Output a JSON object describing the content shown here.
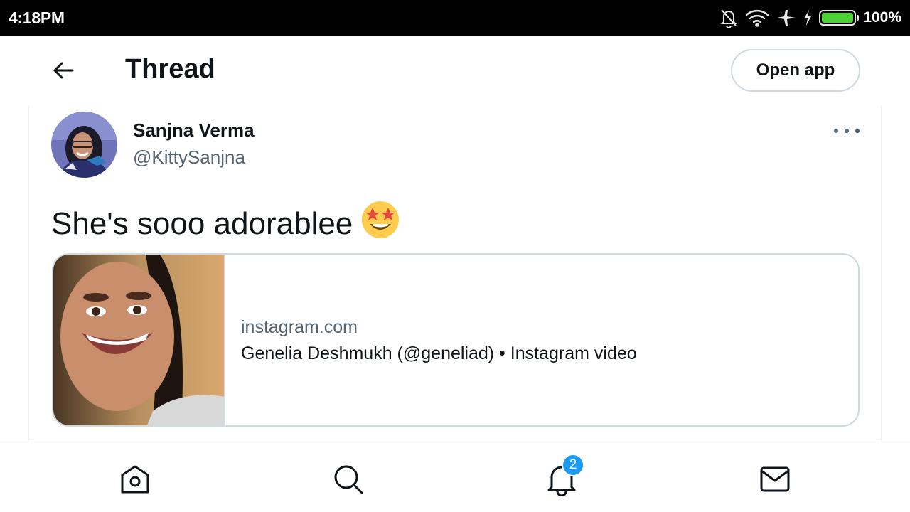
{
  "status_bar": {
    "time": "4:18PM",
    "icons": [
      "bell-off-icon",
      "wifi-icon",
      "airplane-icon",
      "charging-icon",
      "battery-icon"
    ],
    "battery_percent": "100%",
    "battery_level": 1.0,
    "battery_color": "#4cd137"
  },
  "header": {
    "back_icon": "arrow-left-icon",
    "title": "Thread",
    "open_app_label": "Open app"
  },
  "tweet": {
    "author_name": "Sanjna Verma",
    "author_handle": "@KittySanjna",
    "more_icon": "more-horizontal-icon",
    "text": "She's sooo adorablee",
    "emoji": "star-struck-emoji",
    "link_card": {
      "domain": "instagram.com",
      "title": "Genelia Deshmukh (@geneliad) • Instagram video"
    }
  },
  "bottom_nav": {
    "items": [
      {
        "name": "home",
        "icon": "home-icon"
      },
      {
        "name": "search",
        "icon": "search-icon"
      },
      {
        "name": "notifications",
        "icon": "bell-icon",
        "badge": "2"
      },
      {
        "name": "messages",
        "icon": "mail-icon"
      }
    ],
    "badge_color": "#1d9bf0"
  }
}
